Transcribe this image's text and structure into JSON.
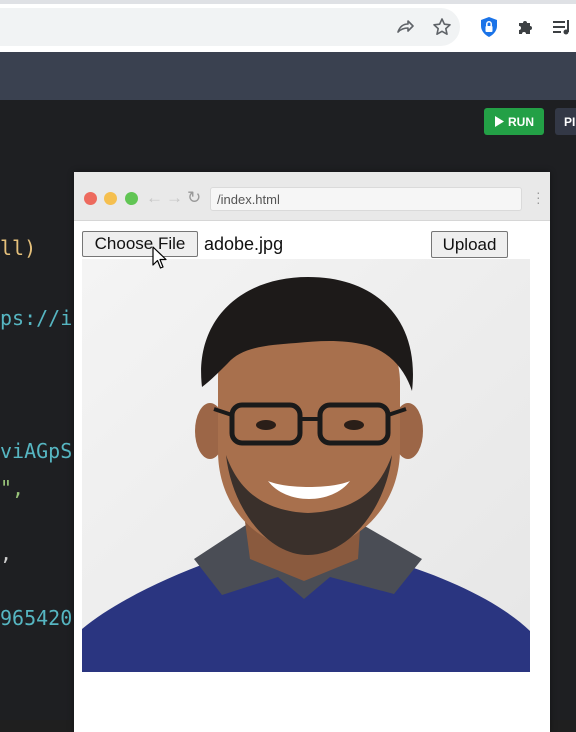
{
  "preview": {
    "url": "/index.html",
    "choose_file_label": "Choose File",
    "file_name": "adobe.jpg",
    "upload_label": "Upload"
  },
  "editor": {
    "run_label": "RUN",
    "second_button_label": "PI",
    "code_fragments": [
      "ll)",
      "ps://i",
      "viAGpS",
      "\",",
      ",",
      "965420"
    ]
  },
  "colors": {
    "run_green": "#23a046",
    "editor_bg": "#1e1f22",
    "header_bg": "#3a4150"
  }
}
